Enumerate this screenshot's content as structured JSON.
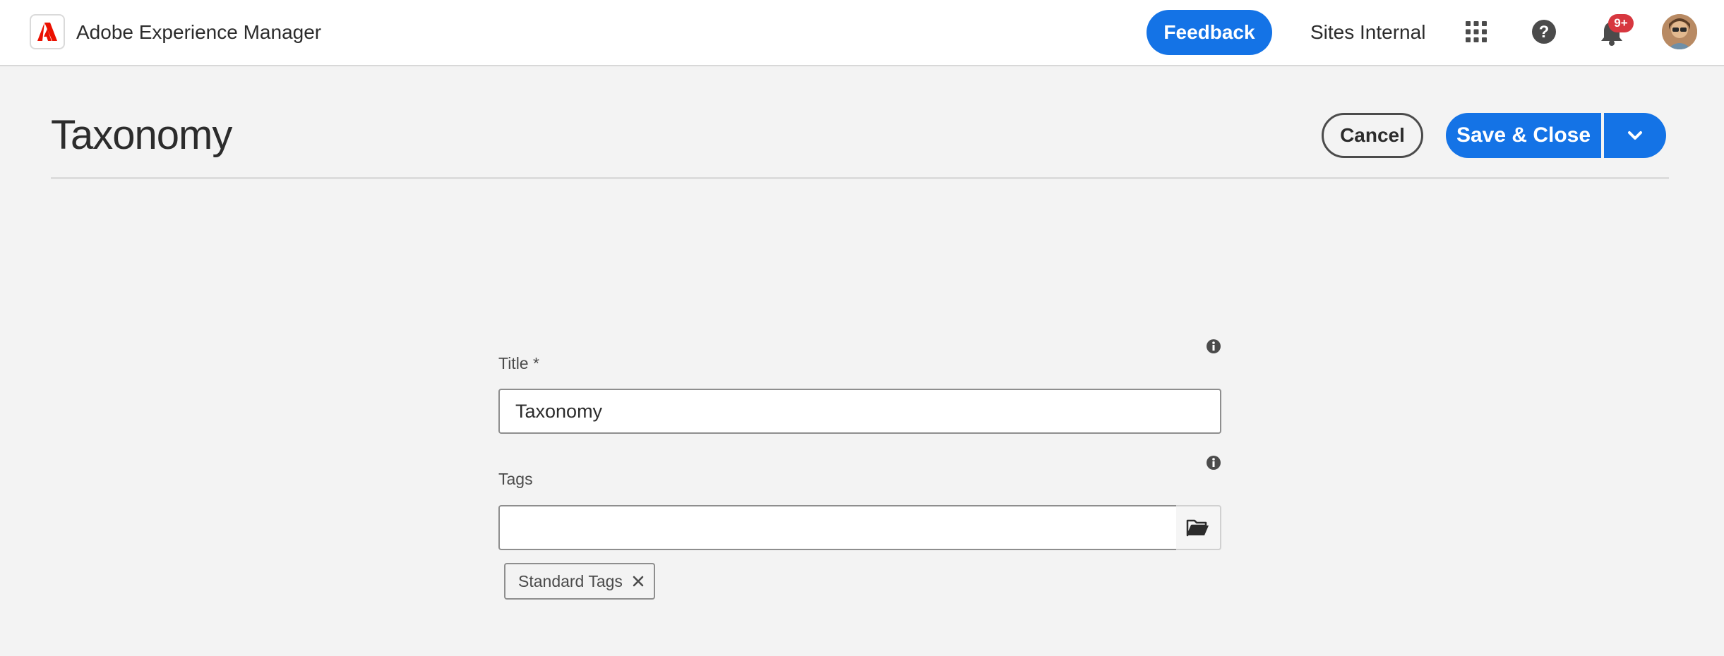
{
  "shell": {
    "app_name": "Adobe Experience Manager",
    "feedback_label": "Feedback",
    "org_name": "Sites Internal",
    "notification_count": "9+",
    "icons": {
      "logo": "adobe-logo-icon",
      "apps": "grid-icon",
      "help": "help-icon",
      "notifications": "bell-icon",
      "avatar": "user-avatar"
    }
  },
  "page": {
    "title": "Taxonomy",
    "cancel_label": "Cancel",
    "save_label": "Save & Close"
  },
  "form": {
    "title_field": {
      "label": "Title *",
      "value": "Taxonomy"
    },
    "tags_field": {
      "label": "Tags",
      "value": "",
      "tags": [
        "Standard Tags"
      ]
    }
  },
  "colors": {
    "accent": "#1473e6",
    "adobe_red": "#eb1000",
    "badge": "#d7373f",
    "background": "#f3f3f3"
  }
}
